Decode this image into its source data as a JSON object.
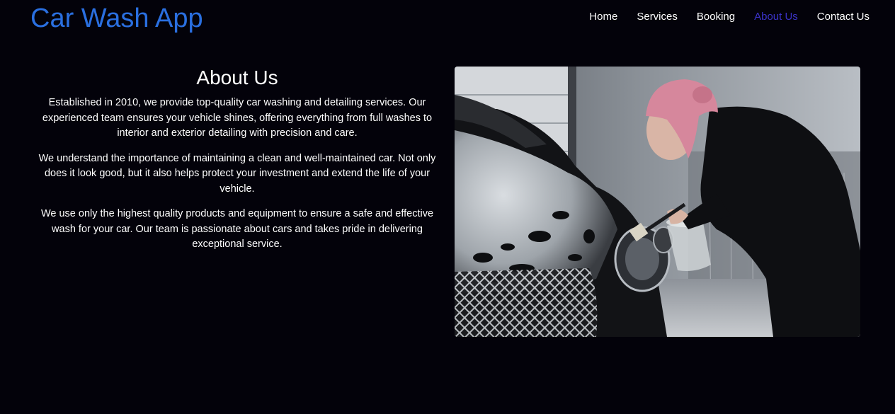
{
  "header": {
    "brand": "Car Wash App",
    "nav": [
      {
        "label": "Home"
      },
      {
        "label": "Services"
      },
      {
        "label": "Booking"
      },
      {
        "label": "About Us",
        "active": true
      },
      {
        "label": "Contact Us"
      }
    ]
  },
  "about": {
    "title": "About Us",
    "paragraphs": [
      "Established in 2010, we provide top-quality car washing and detailing services. Our experienced team ensures your vehicle shines, offering everything from full washes to interior and exterior detailing with precision and care.",
      "We understand the importance of maintaining a clean and well-maintained car. Not only does it look good, but it also helps protect your investment and extend the life of your vehicle.",
      "We use only the highest quality products and equipment to ensure a safe and effective wash for your car. Our team is passionate about cars and takes pride in delivering exceptional service."
    ]
  },
  "colors": {
    "background": "#03020a",
    "brand": "#2a6fe0",
    "nav_active": "#3b33c9",
    "text": "#ffffff"
  }
}
